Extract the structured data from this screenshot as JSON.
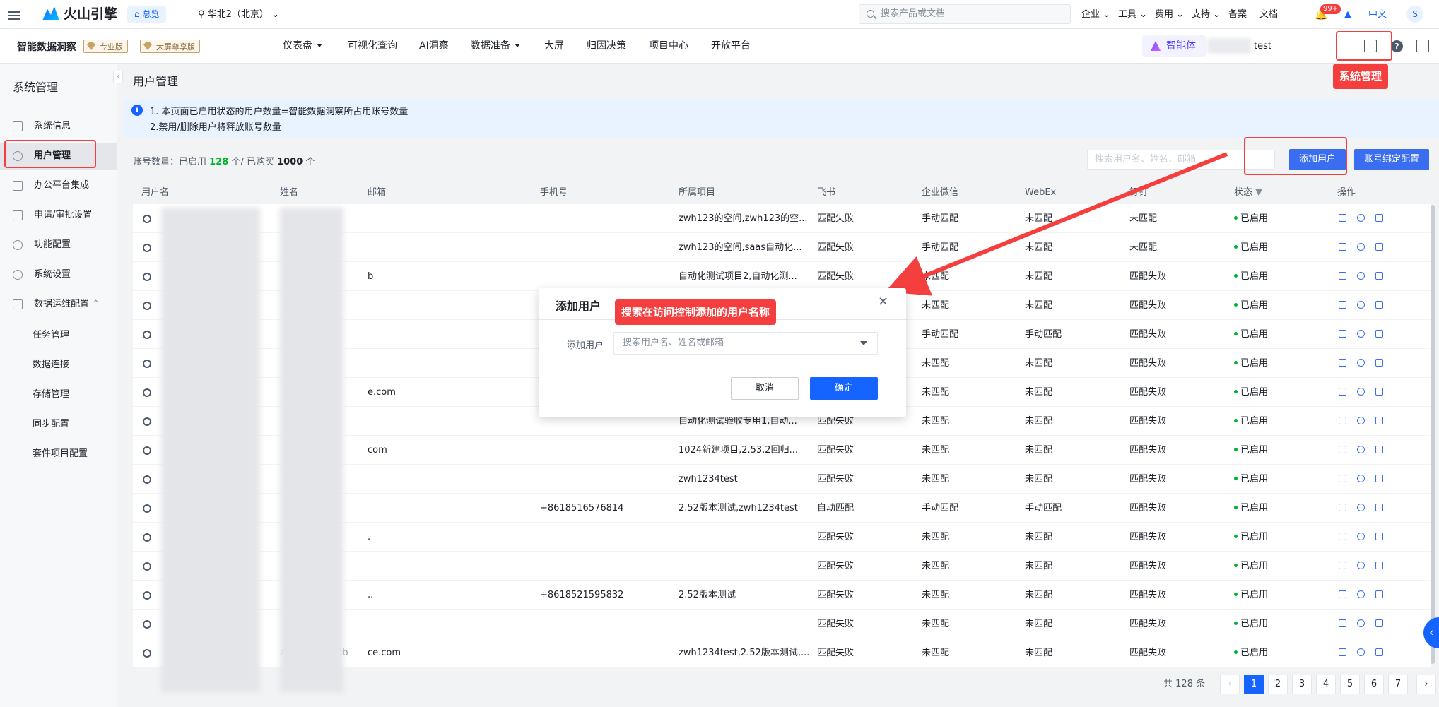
{
  "topbar": {
    "brand": "火山引擎",
    "home": "总览",
    "region": "华北2（北京）",
    "search_placeholder": "搜索产品或文档",
    "menus": [
      "企业",
      "工具",
      "费用",
      "支持"
    ],
    "links": [
      "备案",
      "文档"
    ],
    "notif_count": "99+",
    "lang": "中文",
    "avatar": "S"
  },
  "subbar": {
    "product": "智能数据洞察",
    "editions": [
      "专业版",
      "大屏尊享版"
    ],
    "nav": [
      {
        "label": "仪表盘",
        "dropdown": true
      },
      {
        "label": "可视化查询",
        "dropdown": false
      },
      {
        "label": "AI洞察",
        "dropdown": false
      },
      {
        "label": "数据准备",
        "dropdown": true
      },
      {
        "label": "大屏",
        "dropdown": false
      },
      {
        "label": "归因决策",
        "dropdown": false
      },
      {
        "label": "项目中心",
        "dropdown": false
      },
      {
        "label": "开放平台",
        "dropdown": false
      }
    ],
    "agent": "智能体",
    "user_suffix": "test"
  },
  "annotations": {
    "system_admin": "系统管理",
    "search_hint": "搜索在访问控制添加的用户名称"
  },
  "sidebar": {
    "title": "系统管理",
    "items": [
      "系统信息",
      "用户管理",
      "办公平台集成",
      "申请/审批设置",
      "功能配置",
      "系统设置",
      "数据运维配置"
    ],
    "sub_items": [
      "任务管理",
      "数据连接",
      "存储管理",
      "同步配置",
      "套件项目配置"
    ]
  },
  "page": {
    "title": "用户管理",
    "notice_line1": "1. 本页面已启用状态的用户数量=智能数据洞察所占用账号数量",
    "notice_line2": "2.禁用/删除用户将释放账号数量",
    "count_label": "账号数量：已启用",
    "enabled_count": "128",
    "count_mid": "个/ 已购买",
    "purchased_count": "1000",
    "count_unit": "个",
    "search_placeholder": "搜索用户名、姓名、邮箱",
    "add_user": "添加用户",
    "bind_config": "账号绑定配置"
  },
  "table": {
    "headers": [
      "用户名",
      "姓名",
      "邮箱",
      "手机号",
      "所属项目",
      "飞书",
      "企业微信",
      "WebEx",
      "钉钉",
      "状态",
      "操作"
    ],
    "rows": [
      {
        "email": "",
        "phone": "",
        "project": "zwh123的空间,zwh123的空...",
        "feishu": "匹配失败",
        "wecom": "手动匹配",
        "webex": "未匹配",
        "dingtalk": "未匹配",
        "status": "已启用"
      },
      {
        "email": "",
        "phone": "",
        "project": "zwh123的空间,saas自动化...",
        "feishu": "匹配失败",
        "wecom": "手动匹配",
        "webex": "未匹配",
        "dingtalk": "未匹配",
        "status": "已启用"
      },
      {
        "email": "b",
        "phone": "",
        "project": "自动化测试项目2,自动化测...",
        "feishu": "匹配失败",
        "wecom": "未匹配",
        "webex": "未匹配",
        "dingtalk": "匹配失败",
        "status": "已启用"
      },
      {
        "email": "",
        "phone": "",
        "project": "",
        "feishu": "",
        "wecom": "未匹配",
        "webex": "未匹配",
        "dingtalk": "匹配失败",
        "status": "已启用"
      },
      {
        "email": "",
        "phone": "",
        "project": "",
        "feishu": "",
        "wecom": "手动匹配",
        "webex": "手动匹配",
        "dingtalk": "匹配失败",
        "status": "已启用"
      },
      {
        "email": "",
        "phone": "",
        "project": "",
        "feishu": "",
        "wecom": "未匹配",
        "webex": "未匹配",
        "dingtalk": "匹配失败",
        "status": "已启用"
      },
      {
        "email": "e.com",
        "phone": "",
        "project": "",
        "feishu": "",
        "wecom": "未匹配",
        "webex": "未匹配",
        "dingtalk": "匹配失败",
        "status": "已启用"
      },
      {
        "email": "",
        "phone": "",
        "project": "自动化测试验收专用1,自动...",
        "feishu": "匹配失败",
        "wecom": "未匹配",
        "webex": "未匹配",
        "dingtalk": "匹配失败",
        "status": "已启用"
      },
      {
        "email": "com",
        "phone": "",
        "project": "1024新建项目,2.53.2回归...",
        "feishu": "匹配失败",
        "wecom": "未匹配",
        "webex": "未匹配",
        "dingtalk": "匹配失败",
        "status": "已启用"
      },
      {
        "email": "",
        "phone": "",
        "project": "zwh1234test",
        "feishu": "匹配失败",
        "wecom": "未匹配",
        "webex": "未匹配",
        "dingtalk": "匹配失败",
        "status": "已启用"
      },
      {
        "email": "",
        "phone": "+8618516576814",
        "project": "2.52版本测试,zwh1234test",
        "feishu": "自动匹配",
        "wecom": "手动匹配",
        "webex": "手动匹配",
        "dingtalk": "匹配失败",
        "status": "已启用"
      },
      {
        "email": ".",
        "phone": "",
        "project": "",
        "feishu": "匹配失败",
        "wecom": "未匹配",
        "webex": "未匹配",
        "dingtalk": "匹配失败",
        "status": "已启用"
      },
      {
        "email": "",
        "phone": "",
        "project": "",
        "feishu": "匹配失败",
        "wecom": "未匹配",
        "webex": "未匹配",
        "dingtalk": "匹配失败",
        "status": "已启用"
      },
      {
        "email": "..",
        "phone": "+8618521595832",
        "project": "2.52版本测试",
        "feishu": "匹配失败",
        "wecom": "未匹配",
        "webex": "未匹配",
        "dingtalk": "匹配失败",
        "status": "已启用"
      },
      {
        "email": "",
        "phone": "",
        "project": "",
        "feishu": "匹配失败",
        "wecom": "未匹配",
        "webex": "未匹配",
        "dingtalk": "匹配失败",
        "status": "已启用"
      },
      {
        "email": "ce.com",
        "phone": "",
        "project": "zwh1234test,2.52版本测试,...",
        "feishu": "匹配失败",
        "wecom": "未匹配",
        "webex": "未匹配",
        "dingtalk": "匹配失败",
        "status": "已启用"
      }
    ],
    "partial_name_last_row": "zwh_0820_30b"
  },
  "modal": {
    "title": "添加用户",
    "field_label": "添加用户",
    "select_placeholder": "搜索用户名、姓名或邮箱",
    "cancel": "取消",
    "confirm": "确定"
  },
  "pagination": {
    "total_prefix": "共",
    "total": "128",
    "total_suffix": "条",
    "pages": [
      "1",
      "2",
      "3",
      "4",
      "5",
      "6",
      "7"
    ],
    "current": "1"
  },
  "colors": {
    "primary": "#1664ff",
    "annotation_red": "#f53f3f",
    "status_green": "#00b42a"
  }
}
